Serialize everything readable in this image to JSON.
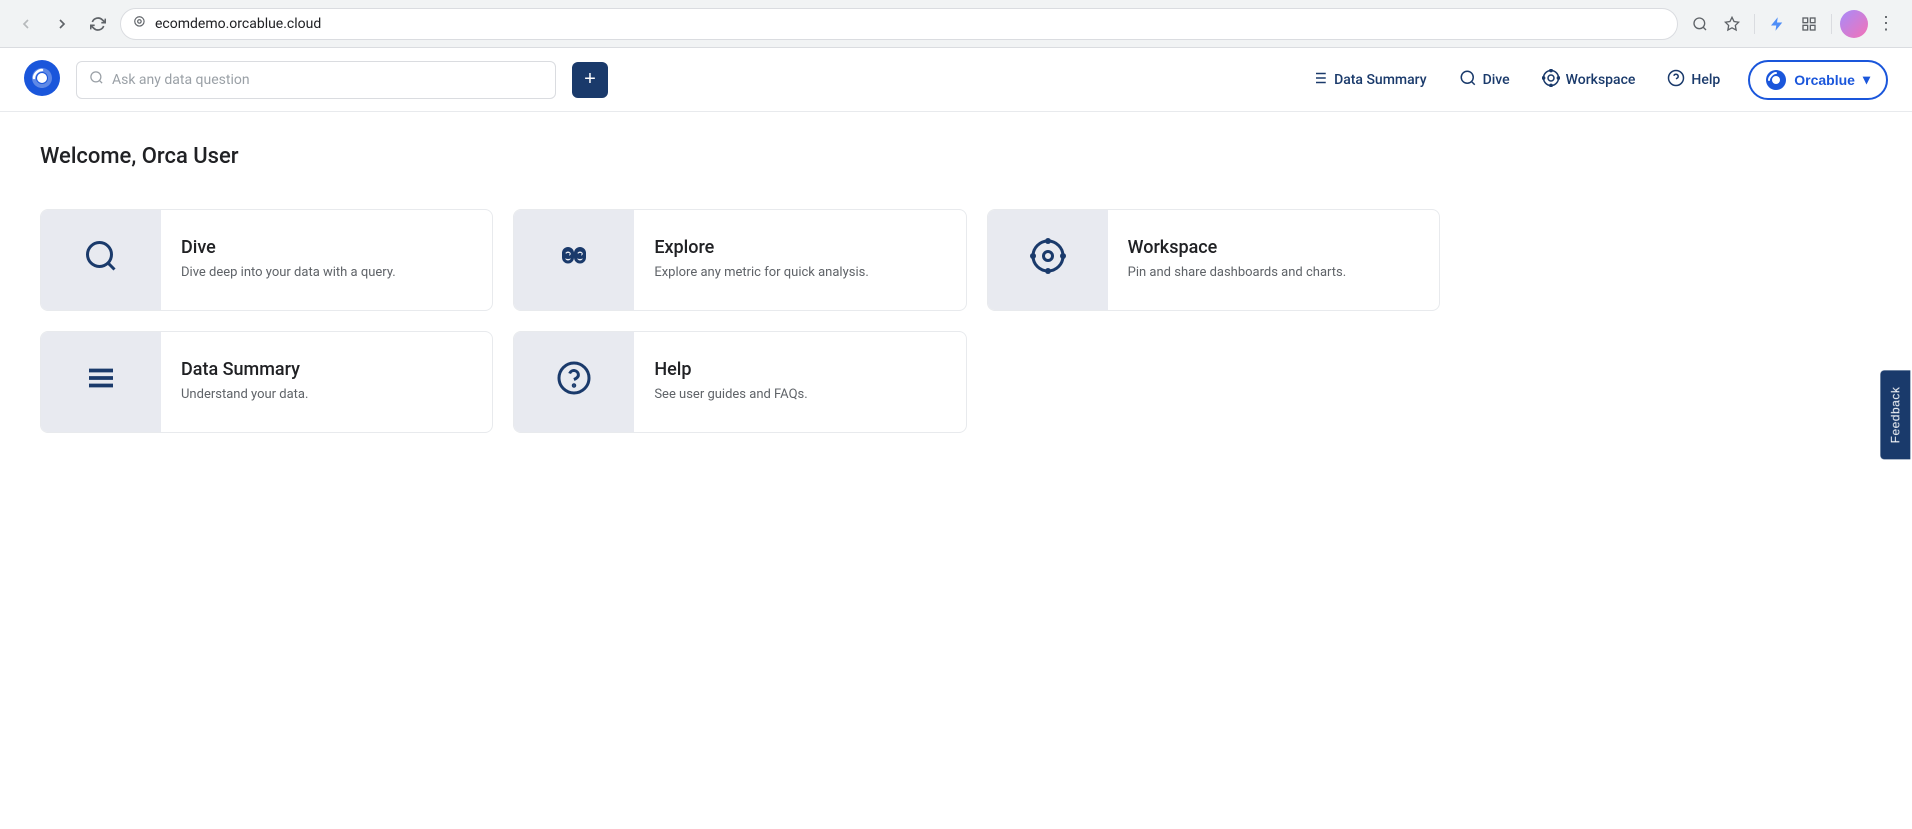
{
  "browser": {
    "url": "ecomdemo.orcablue.cloud",
    "back_disabled": false,
    "forward_disabled": true
  },
  "header": {
    "search_placeholder": "Ask any data question",
    "plus_label": "+",
    "nav": [
      {
        "id": "data-summary",
        "label": "Data Summary",
        "icon": "list-icon"
      },
      {
        "id": "dive",
        "label": "Dive",
        "icon": "search-icon"
      },
      {
        "id": "workspace",
        "label": "Workspace",
        "icon": "workspace-icon"
      },
      {
        "id": "help",
        "label": "Help",
        "icon": "help-icon"
      }
    ],
    "brand_label": "Orcablue",
    "brand_chevron": "▾"
  },
  "main": {
    "welcome": "Welcome, Orca User",
    "cards": [
      {
        "id": "dive",
        "title": "Dive",
        "description": "Dive deep into your data with a query.",
        "icon": "search-icon"
      },
      {
        "id": "explore",
        "title": "Explore",
        "description": "Explore any metric for quick analysis.",
        "icon": "binoculars-icon"
      },
      {
        "id": "workspace",
        "title": "Workspace",
        "description": "Pin and share dashboards and charts.",
        "icon": "workspace-icon"
      },
      {
        "id": "data-summary",
        "title": "Data Summary",
        "description": "Understand your data.",
        "icon": "list-icon"
      },
      {
        "id": "help",
        "title": "Help",
        "description": "See user guides and FAQs.",
        "icon": "help-icon"
      }
    ]
  },
  "feedback": {
    "label": "Feedback"
  }
}
